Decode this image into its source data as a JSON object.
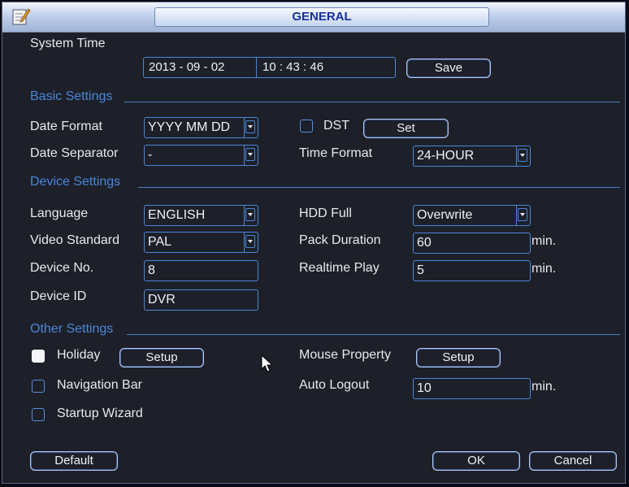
{
  "window": {
    "title": "GENERAL"
  },
  "system_time": {
    "label": "System Time",
    "date": "2013  -  09  -  02",
    "time": "10  :  43  :  46",
    "save_label": "Save"
  },
  "basic": {
    "section_label": "Basic Settings",
    "date_format_label": "Date Format",
    "date_format_value": "YYYY MM DD",
    "dst_label": "DST",
    "dst_checked": false,
    "set_label": "Set",
    "date_separator_label": "Date Separator",
    "date_separator_value": "-",
    "time_format_label": "Time Format",
    "time_format_value": "24-HOUR"
  },
  "device": {
    "section_label": "Device Settings",
    "language_label": "Language",
    "language_value": "ENGLISH",
    "hdd_full_label": "HDD Full",
    "hdd_full_value": "Overwrite",
    "video_standard_label": "Video Standard",
    "video_standard_value": "PAL",
    "pack_duration_label": "Pack Duration",
    "pack_duration_value": "60",
    "pack_duration_unit": "min.",
    "device_no_label": "Device No.",
    "device_no_value": "8",
    "realtime_play_label": "Realtime Play",
    "realtime_play_value": "5",
    "realtime_play_unit": "min.",
    "device_id_label": "Device ID",
    "device_id_value": "DVR"
  },
  "other": {
    "section_label": "Other Settings",
    "holiday_label": "Holiday",
    "holiday_checked": true,
    "holiday_setup_label": "Setup",
    "mouse_property_label": "Mouse Property",
    "mouse_setup_label": "Setup",
    "navigation_bar_label": "Navigation Bar",
    "navigation_bar_checked": false,
    "auto_logout_label": "Auto Logout",
    "auto_logout_value": "10",
    "auto_logout_unit": "min.",
    "startup_wizard_label": "Startup Wizard",
    "startup_wizard_checked": false
  },
  "footer": {
    "default_label": "Default",
    "ok_label": "OK",
    "cancel_label": "Cancel"
  },
  "colors": {
    "background": "#1d2029",
    "accent_blue": "#4a86d8",
    "title_text": "#1a2fa0"
  },
  "icons": {
    "app": "settings-pencil-icon",
    "cursor": "mouse-pointer-icon"
  }
}
